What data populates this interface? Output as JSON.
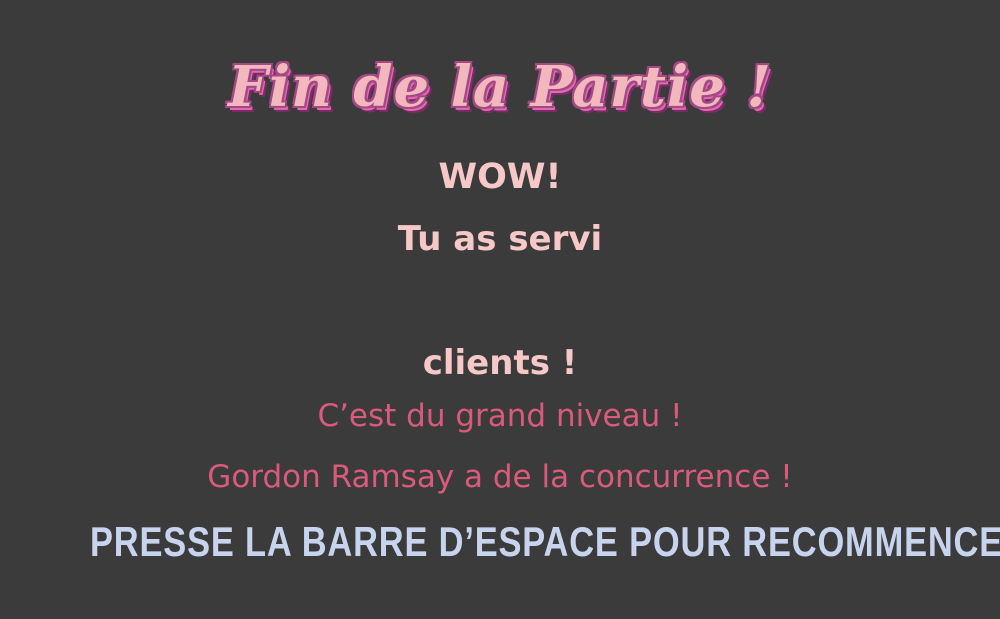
{
  "screen": {
    "title": "Fin de la Partie !",
    "wow": "WOW!",
    "served_prefix": "Tu as servi",
    "served_count": "",
    "served_suffix": "clients !",
    "compliment": "C’est du grand niveau !",
    "ramsay_line": "Gordon Ramsay a de la concurrence !",
    "restart_prompt": "PRESSE LA BARRE D’ESPACE POUR RECOMMENCER"
  },
  "colors": {
    "background": "#3b3b3b",
    "title_fill": "#f3b7be",
    "title_outline": "#a34a86",
    "primary_text": "#f6c8c8",
    "secondary_text": "#d95a7a",
    "prompt_text": "#c8d3ee"
  }
}
